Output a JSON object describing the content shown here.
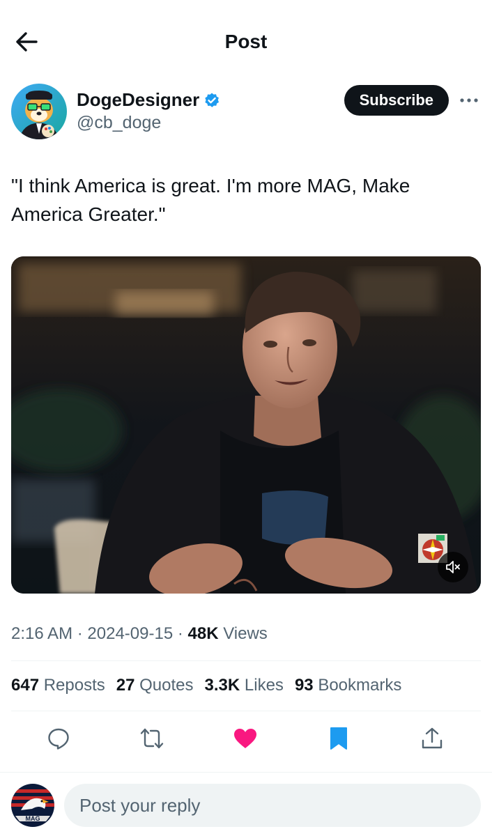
{
  "header": {
    "title": "Post",
    "back_icon": "arrow-left-icon"
  },
  "author": {
    "display_name": "DogeDesigner",
    "handle": "@cb_doge",
    "verified": true,
    "verified_color": "#1d9bf0",
    "subscribe_label": "Subscribe",
    "more_icon": "more-horizontal-icon"
  },
  "post": {
    "text": "\"I think America is great. I'm more MAG, Make America Greater.\"",
    "media": {
      "type": "video",
      "muted": true,
      "mute_icon": "speaker-muted-icon"
    }
  },
  "meta": {
    "time": "2:16 AM",
    "date": "2024-09-15",
    "views_count": "48K",
    "views_label": "Views",
    "separator": "·"
  },
  "stats": {
    "reposts_count": "647",
    "reposts_label": "Reposts",
    "quotes_count": "27",
    "quotes_label": "Quotes",
    "likes_count": "3.3K",
    "likes_label": "Likes",
    "bookmarks_count": "93",
    "bookmarks_label": "Bookmarks"
  },
  "actions": {
    "reply_icon": "reply-icon",
    "repost_icon": "repost-icon",
    "like_icon": "heart-filled-icon",
    "bookmark_icon": "bookmark-filled-icon",
    "share_icon": "share-icon",
    "liked": true,
    "bookmarked": true,
    "like_color": "#f91880",
    "bookmark_color": "#1d9bf0"
  },
  "reply": {
    "placeholder": "Post your reply"
  },
  "my_avatar": {
    "badge_text": "MAG"
  },
  "colors": {
    "text_primary": "#0f1419",
    "text_secondary": "#536471",
    "divider": "#eff3f4",
    "accent": "#1d9bf0"
  }
}
